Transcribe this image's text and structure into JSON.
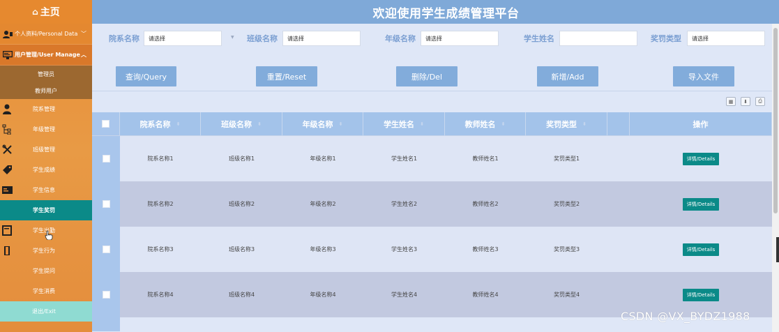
{
  "sidebar": {
    "home": "主页",
    "groups": [
      {
        "label": "个人资料/Personal Data",
        "chevron": "﹀"
      },
      {
        "label": "用户管理/User Manage",
        "chevron": "︿"
      }
    ],
    "subitems": [
      "管理员",
      "教师用户"
    ],
    "items": [
      {
        "label": "院系管理",
        "icon": "user-icon"
      },
      {
        "label": "年级管理",
        "icon": "sitemap-icon"
      },
      {
        "label": "班级管理",
        "icon": "tools-icon"
      },
      {
        "label": "学生成绩",
        "icon": "tag-icon"
      },
      {
        "label": "学生信息",
        "icon": "id-card-icon"
      },
      {
        "label": "学生奖罚",
        "icon": "",
        "active": true
      },
      {
        "label": "学生出勤",
        "icon": "book-icon"
      },
      {
        "label": "学生行为",
        "icon": "door-icon"
      },
      {
        "label": "学生提问",
        "icon": ""
      },
      {
        "label": "学生消费",
        "icon": ""
      }
    ],
    "exit": "退出/Exit",
    "colors": {
      "accent": "#e98c36",
      "active": "#0b8a88",
      "exit": "#8fdbd2"
    }
  },
  "header": {
    "title": "欢迎使用学生成绩管理平台",
    "bg": "#7fa9d8"
  },
  "filters": [
    {
      "label": "院系名称",
      "placeholder": "请选择"
    },
    {
      "label": "班级名称",
      "placeholder": "请选择"
    },
    {
      "label": "年级名称",
      "placeholder": "请选择"
    },
    {
      "label": "学生姓名",
      "placeholder": ""
    },
    {
      "label": "奖罚类型",
      "placeholder": "请选择"
    }
  ],
  "buttons": {
    "query": "查询/Query",
    "reset": "重置/Reset",
    "delete": "删除/Del",
    "add": "新增/Add",
    "import": "导入文件"
  },
  "toolbar": {
    "icons": [
      "grid-icon",
      "user-export-icon",
      "print-icon"
    ]
  },
  "table": {
    "headers": [
      "院系名称",
      "班级名称",
      "年级名称",
      "学生姓名",
      "教师姓名",
      "奖罚类型",
      "",
      "操作"
    ],
    "rows": [
      [
        "院系名称1",
        "班级名称1",
        "年级名称1",
        "学生姓名1",
        "教师姓名1",
        "奖罚类型1"
      ],
      [
        "院系名称2",
        "班级名称2",
        "年级名称2",
        "学生姓名2",
        "教师姓名2",
        "奖罚类型2"
      ],
      [
        "院系名称3",
        "班级名称3",
        "年级名称3",
        "学生姓名3",
        "教师姓名3",
        "奖罚类型3"
      ],
      [
        "院系名称4",
        "班级名称4",
        "年级名称4",
        "学生姓名4",
        "教师姓名4",
        "奖罚类型4"
      ]
    ],
    "action_label": "详情/Details",
    "colors": {
      "header": "#a3c3ea",
      "action": "#0b8a88"
    }
  },
  "watermark": "CSDN @VX_BYDZ1988"
}
